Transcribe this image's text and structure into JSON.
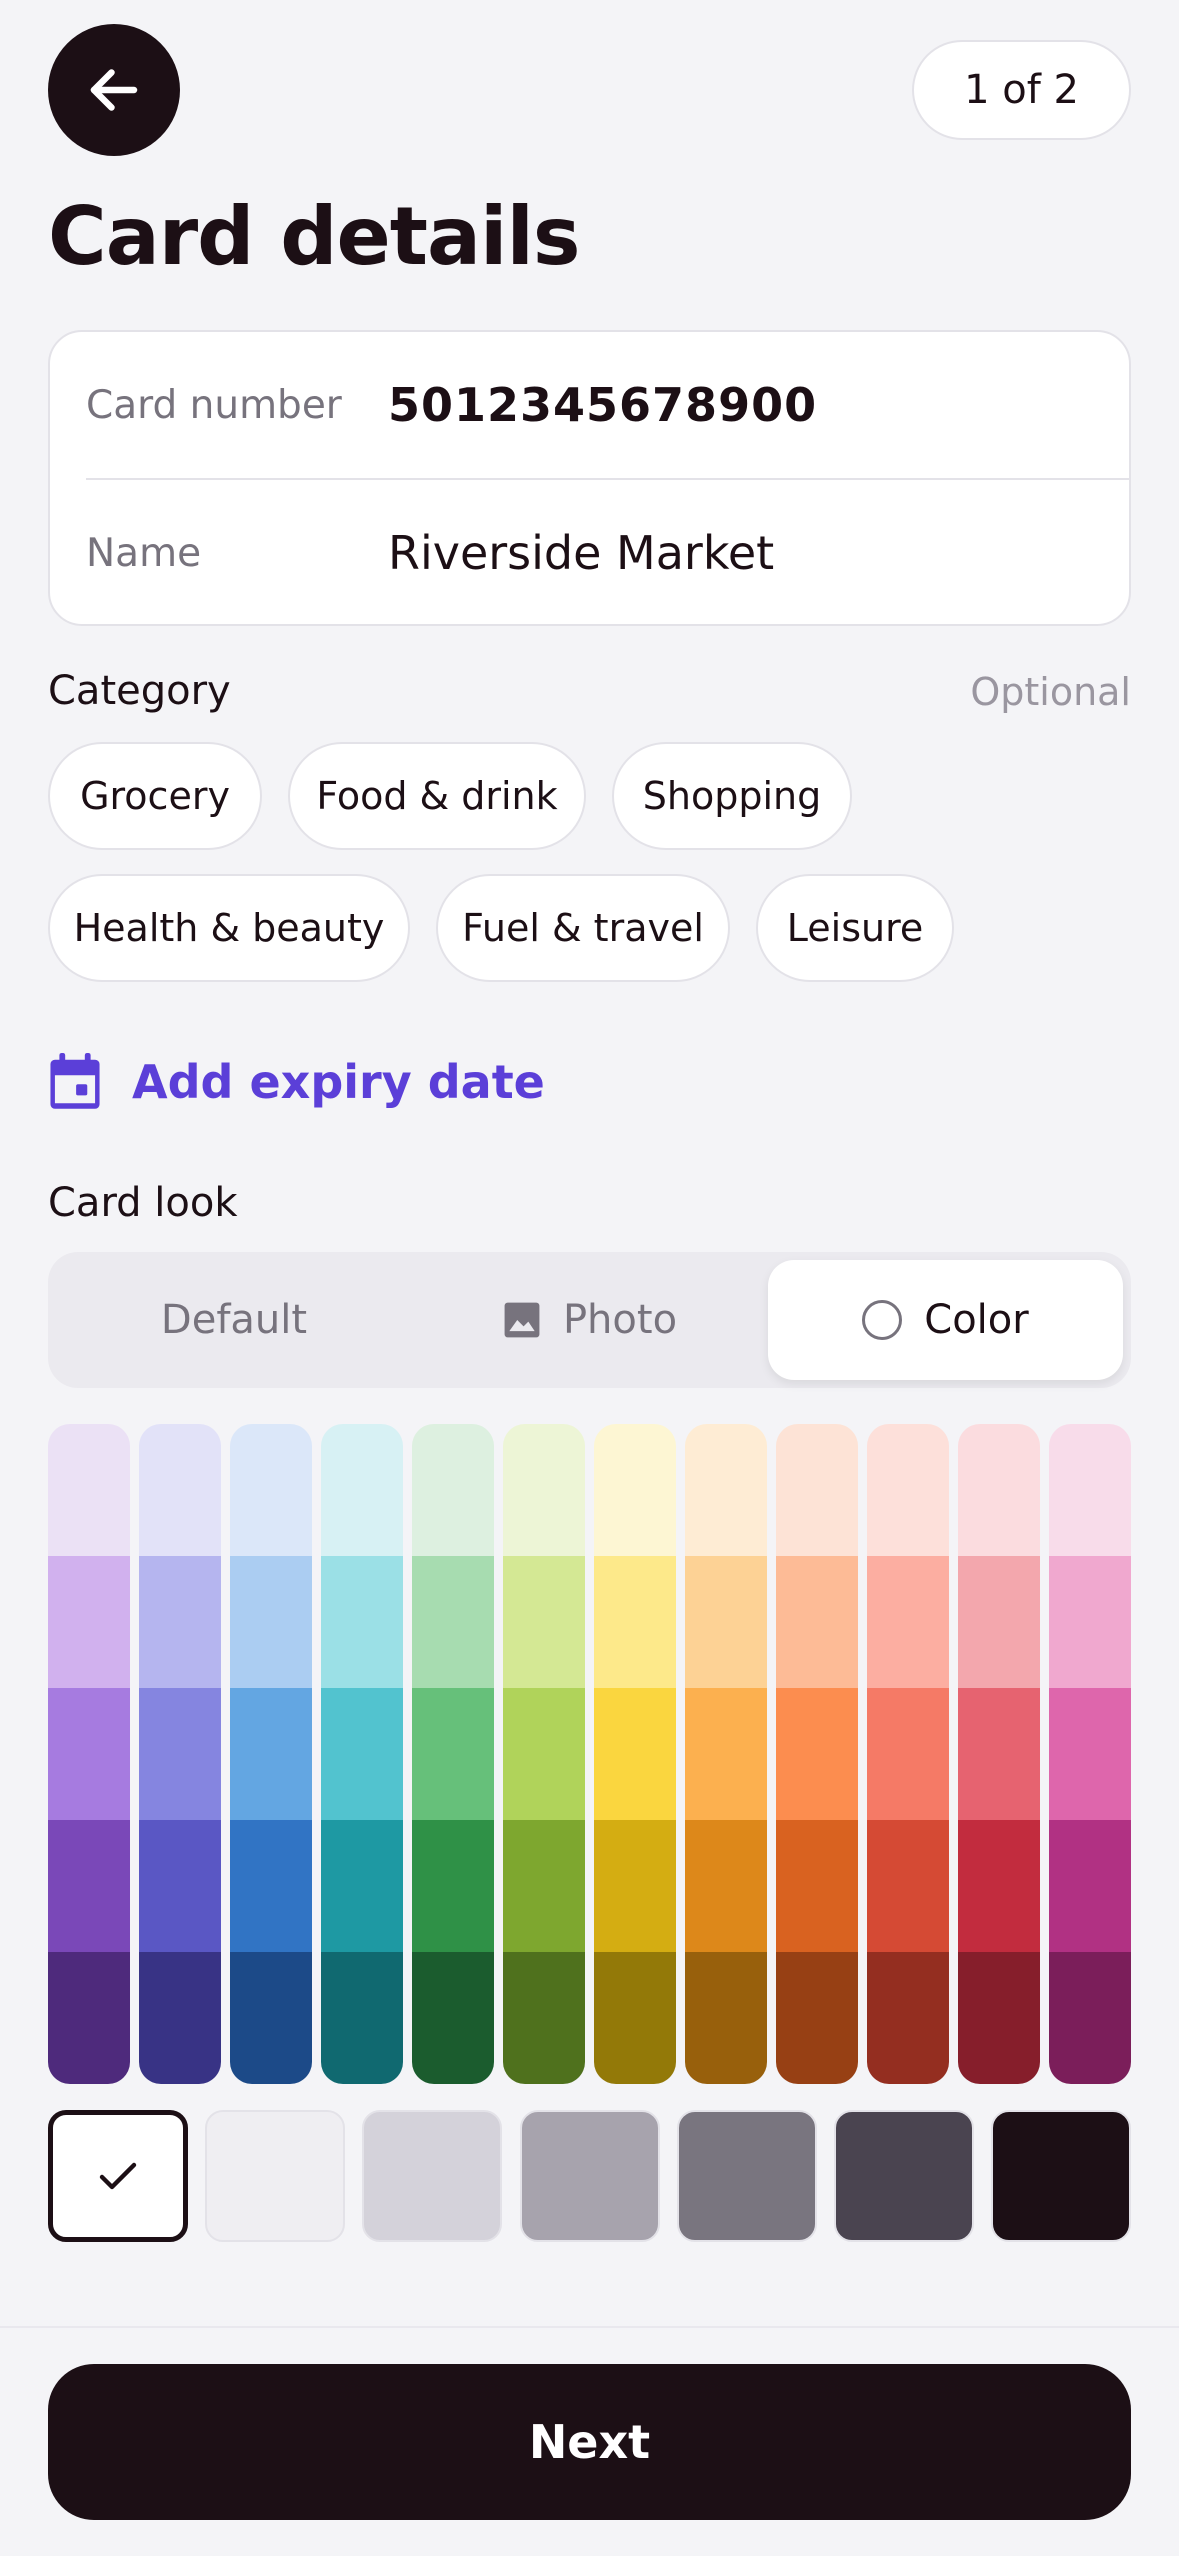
{
  "header": {
    "back_icon": "arrow-left-icon",
    "step": "1 of 2",
    "title": "Card details"
  },
  "form": {
    "card_number_label": "Card number",
    "card_number_value": "5012345678900",
    "name_label": "Name",
    "name_value": "Riverside Market"
  },
  "category": {
    "label": "Category",
    "optional": "Optional",
    "chips": [
      "Grocery",
      "Food & drink",
      "Shopping",
      "Health & beauty",
      "Fuel & travel",
      "Leisure"
    ]
  },
  "expiry": {
    "icon": "calendar-icon",
    "label": "Add expiry date",
    "color": "#5b3fd8"
  },
  "card_look": {
    "label": "Card look",
    "options": [
      {
        "label": "Default",
        "icon": ""
      },
      {
        "label": "Photo",
        "icon": "image-icon"
      },
      {
        "label": "Color",
        "icon": "radio-icon"
      }
    ],
    "selected": "Color"
  },
  "palette": {
    "columns": [
      [
        "#ebe1f5",
        "#d1b1ee",
        "#a67be0",
        "#7a48b8",
        "#4e2a7c"
      ],
      [
        "#e2e2f8",
        "#b5b5ef",
        "#8585e0",
        "#5a57c4",
        "#383385"
      ],
      [
        "#dbe7f9",
        "#abcdf2",
        "#63a6e2",
        "#3174c4",
        "#1c4a88"
      ],
      [
        "#d7f1f4",
        "#9be0e6",
        "#52c3cf",
        "#1e99a3",
        "#106970"
      ],
      [
        "#ddf0e0",
        "#a7dcb0",
        "#66c07a",
        "#2f9147",
        "#1b5c2e"
      ],
      [
        "#edf5d6",
        "#d4e894",
        "#b0d35a",
        "#7ea72f",
        "#4f711d"
      ],
      [
        "#fdf6d3",
        "#fde98a",
        "#fad63f",
        "#d4ad12",
        "#937908"
      ],
      [
        "#feecd4",
        "#fdd295",
        "#fcb04f",
        "#dd881a",
        "#98600c"
      ],
      [
        "#fde3d6",
        "#fdbb96",
        "#fc8d4f",
        "#d96220",
        "#974014"
      ],
      [
        "#fde0da",
        "#fcaea1",
        "#f57a66",
        "#d54a34",
        "#942e20"
      ],
      [
        "#fbdcdf",
        "#f3a7ad",
        "#e66370",
        "#c22c3e",
        "#861e2b"
      ],
      [
        "#f8dcea",
        "#f0a8cf",
        "#de66ac",
        "#b13183",
        "#7b1e5a"
      ]
    ],
    "neutrals": [
      "#ffffff",
      "#efeef2",
      "#d4d2da",
      "#a7a3ad",
      "#79757f",
      "#4a4450",
      "#1c0f15"
    ],
    "selected_neutral": "#ffffff",
    "selected_icon": "checkmark-icon"
  },
  "footer": {
    "next_label": "Next"
  }
}
